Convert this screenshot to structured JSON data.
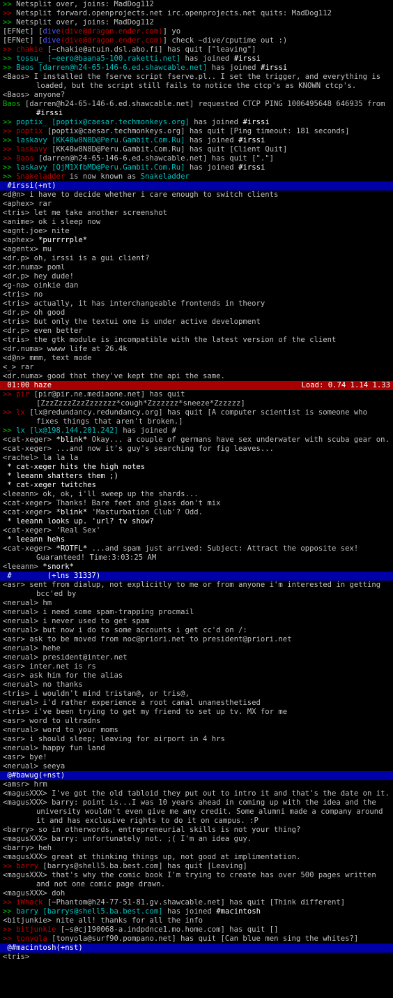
{
  "window": {
    "title": "irssi"
  },
  "lines": [
    {
      "kind": "line",
      "segs": [
        [
          ">> ",
          "g"
        ],
        [
          "Netsplit over, joins: MadDog112",
          ""
        ]
      ]
    },
    {
      "kind": "line",
      "segs": [
        [
          ">> ",
          "r"
        ],
        [
          "Netsplit forward.openprojects.net irc.openprojects.net quits: MadDog112",
          ""
        ]
      ]
    },
    {
      "kind": "line",
      "segs": [
        [
          ">> ",
          "g"
        ],
        [
          "Netsplit over, joins: MadDog112",
          ""
        ]
      ]
    },
    {
      "kind": "line",
      "segs": [
        [
          "[EFNet] [",
          ""
        ],
        [
          "dive",
          "b"
        ],
        [
          "(dive@dragon.ender.com)",
          "r"
        ],
        [
          "] yo",
          ""
        ]
      ]
    },
    {
      "kind": "line",
      "segs": [
        [
          "[EFNet] [",
          ""
        ],
        [
          "dive",
          "b"
        ],
        [
          "(dive@dragon.ender.com)",
          "r"
        ],
        [
          "] check ~dive/cputime out :)",
          ""
        ]
      ]
    },
    {
      "kind": "line",
      "segs": [
        [
          ">> ",
          "r"
        ],
        [
          "chakie ",
          "r"
        ],
        [
          "[~chakie@atuin.dsl.abo.fi] has quit [\"leaving\"]",
          ""
        ]
      ]
    },
    {
      "kind": "line",
      "segs": [
        [
          ">> ",
          "g"
        ],
        [
          "tossu_ ",
          "c"
        ],
        [
          "[~eero@baana5-100.raketti.net] ",
          "c"
        ],
        [
          "has joined ",
          ""
        ],
        [
          "#irssi",
          "w"
        ]
      ]
    },
    {
      "kind": "line",
      "segs": [
        [
          ">> ",
          "g"
        ],
        [
          "Baos ",
          "c"
        ],
        [
          "[darren@h24-65-146-6.ed.shawcable.net] ",
          "c"
        ],
        [
          "has joined ",
          ""
        ],
        [
          "#irssi",
          "w"
        ]
      ]
    },
    {
      "kind": "wrap",
      "segs": [
        [
          "<Baos> I installed the fserve script fserve.pl.. I set the trigger, and everything is loaded, but the script still fails to notice the ctcp's as KNOWN ctcp's.",
          ""
        ]
      ]
    },
    {
      "kind": "line",
      "segs": [
        [
          "<Baos> anyone?",
          ""
        ]
      ]
    },
    {
      "kind": "wrap",
      "segs": [
        [
          "Baos ",
          "g"
        ],
        [
          "[darren@h24-65-146-6.ed.shawcable.net] requested CTCP PING 1006495648 646935 from ",
          ""
        ],
        [
          "#irssi",
          "w"
        ]
      ]
    },
    {
      "kind": "line",
      "segs": [
        [
          ">> ",
          "g"
        ],
        [
          "poptix_ ",
          "c"
        ],
        [
          "[poptix@caesar.techmonkeys.org] ",
          "c"
        ],
        [
          "has joined ",
          ""
        ],
        [
          "#irssi",
          "w"
        ]
      ]
    },
    {
      "kind": "line",
      "segs": [
        [
          ">> ",
          "r"
        ],
        [
          "poptix ",
          "r"
        ],
        [
          "[poptix@caesar.techmonkeys.org] has quit [Ping timeout: 181 seconds]",
          ""
        ]
      ]
    },
    {
      "kind": "line",
      "segs": [
        [
          ">> ",
          "g"
        ],
        [
          "laskavy ",
          "c"
        ],
        [
          "[KK48w8N8D@Peru.Gambit.Com.Ru] ",
          "c"
        ],
        [
          "has joined ",
          ""
        ],
        [
          "#irssi",
          "w"
        ]
      ]
    },
    {
      "kind": "line",
      "segs": [
        [
          ">> ",
          "r"
        ],
        [
          "laskavy ",
          "r"
        ],
        [
          "[KK48w8N8D@Peru.Gambit.Com.Ru] has quit [Client Quit]",
          ""
        ]
      ]
    },
    {
      "kind": "line",
      "segs": [
        [
          ">> ",
          "r"
        ],
        [
          "Baos ",
          "r"
        ],
        [
          "[darren@h24-65-146-6.ed.shawcable.net] has quit [\".\"]",
          ""
        ]
      ]
    },
    {
      "kind": "line",
      "segs": [
        [
          ">> ",
          "g"
        ],
        [
          "laskavy ",
          "c"
        ],
        [
          "[QjM1XfbMD@Peru.Gambit.Com.Ru] ",
          "c"
        ],
        [
          "has joined ",
          ""
        ],
        [
          "#irssi",
          "w"
        ]
      ]
    },
    {
      "kind": "line",
      "segs": [
        [
          ">> ",
          "g"
        ],
        [
          "Snakeladder ",
          "r"
        ],
        [
          "is now known as ",
          ""
        ],
        [
          "Snakeladder",
          "c"
        ]
      ]
    },
    {
      "kind": "status",
      "left": " #irssi(+nt)",
      "right": ""
    },
    {
      "kind": "line",
      "segs": [
        [
          "<d@n> i have to decide whether i care enough to switch clients",
          ""
        ]
      ]
    },
    {
      "kind": "line",
      "segs": [
        [
          "<aphex> rar",
          ""
        ]
      ]
    },
    {
      "kind": "line",
      "segs": [
        [
          "<tris> let me take another screenshot",
          ""
        ]
      ]
    },
    {
      "kind": "line",
      "segs": [
        [
          "<anime> ok i sleep now",
          ""
        ]
      ]
    },
    {
      "kind": "line",
      "segs": [
        [
          "<agnt.joe> nite",
          ""
        ]
      ]
    },
    {
      "kind": "line",
      "segs": [
        [
          "<aphex> ",
          ""
        ],
        [
          "*purrrrple*",
          "w"
        ]
      ]
    },
    {
      "kind": "line",
      "segs": [
        [
          "<agentx> mu",
          ""
        ]
      ]
    },
    {
      "kind": "line",
      "segs": [
        [
          "<dr.p> oh, irssi is a gui client?",
          ""
        ]
      ]
    },
    {
      "kind": "line",
      "segs": [
        [
          "<dr.numa> poml",
          ""
        ]
      ]
    },
    {
      "kind": "line",
      "segs": [
        [
          "<dr.p> hey dude!",
          ""
        ]
      ]
    },
    {
      "kind": "line",
      "segs": [
        [
          "<g-na> oinkie dan",
          ""
        ]
      ]
    },
    {
      "kind": "line",
      "segs": [
        [
          "<tris> no",
          ""
        ]
      ]
    },
    {
      "kind": "line",
      "segs": [
        [
          "<tris> actually, it has interchangeable frontends in theory",
          ""
        ]
      ]
    },
    {
      "kind": "line",
      "segs": [
        [
          "<dr.p> oh good",
          ""
        ]
      ]
    },
    {
      "kind": "line",
      "segs": [
        [
          "<tris> but only the textui one is under active development",
          ""
        ]
      ]
    },
    {
      "kind": "line",
      "segs": [
        [
          "<dr.p> even better",
          ""
        ]
      ]
    },
    {
      "kind": "line",
      "segs": [
        [
          "<tris> the gtk module is incompatible with the latest version of the client",
          ""
        ]
      ]
    },
    {
      "kind": "line",
      "segs": [
        [
          "<dr.numa> wwww life at 26.4k",
          ""
        ]
      ]
    },
    {
      "kind": "line",
      "segs": [
        [
          "<d@n> mmm, text mode",
          ""
        ]
      ]
    },
    {
      "kind": "line",
      "segs": [
        [
          "<_> rar",
          ""
        ]
      ]
    },
    {
      "kind": "line",
      "segs": [
        [
          "<dr.numa> good that they've kept the api the same.",
          ""
        ]
      ]
    },
    {
      "kind": "status-red",
      "left": " 01:00 haze",
      "right": "Load: 0.74 1.14 1.33"
    },
    {
      "kind": "wrap",
      "segs": [
        [
          ">> ",
          "r"
        ],
        [
          "pir ",
          "r"
        ],
        [
          "[pir@pir.ne.mediaone.net] has quit [ZzzZzzzZzzZzzzzzz*cough*Zzzzzzz*sneeze*Zzzzzz]",
          ""
        ]
      ]
    },
    {
      "kind": "wrap",
      "segs": [
        [
          ">> ",
          "r"
        ],
        [
          "lx ",
          "r"
        ],
        [
          "[lx@redundancy.redundancy.org] has quit [A computer scientist is someone who fixes things that aren't broken.]",
          ""
        ]
      ]
    },
    {
      "kind": "line",
      "segs": [
        [
          ">> ",
          "g"
        ],
        [
          "lx ",
          "c"
        ],
        [
          "[lx@198.144.201.242] ",
          "c"
        ],
        [
          "has joined #",
          ""
        ]
      ]
    },
    {
      "kind": "wrap",
      "segs": [
        [
          "<cat-xeger> ",
          ""
        ],
        [
          "*blink*",
          "w"
        ],
        [
          " Okay... a couple of germans have sex underwater with scuba gear on.",
          ""
        ]
      ]
    },
    {
      "kind": "line",
      "segs": [
        [
          "<cat-xeger> ...and now it's guy's searching for fig leaves...",
          ""
        ]
      ]
    },
    {
      "kind": "line",
      "segs": [
        [
          "<rachel> la la la",
          ""
        ]
      ]
    },
    {
      "kind": "line",
      "segs": [
        [
          " * cat-xeger hits the high notes",
          "w"
        ]
      ]
    },
    {
      "kind": "line",
      "segs": [
        [
          " * leeann shatters them ;)",
          "w"
        ]
      ]
    },
    {
      "kind": "line",
      "segs": [
        [
          " * cat-xeger twitches",
          "w"
        ]
      ]
    },
    {
      "kind": "line",
      "segs": [
        [
          "<leeann> ok, ok, i'll sweep up the shards...",
          ""
        ]
      ]
    },
    {
      "kind": "line",
      "segs": [
        [
          "<cat-xeger> Thanks! Bare feet and glass don't mix",
          ""
        ]
      ]
    },
    {
      "kind": "line",
      "segs": [
        [
          "<cat-xeger> ",
          ""
        ],
        [
          "*blink*",
          "w"
        ],
        [
          " 'Masturbation Club'? Odd.",
          ""
        ]
      ]
    },
    {
      "kind": "line",
      "segs": [
        [
          " * leeann looks up. 'url? tv show?",
          "w"
        ]
      ]
    },
    {
      "kind": "line",
      "segs": [
        [
          "<cat-xeger> 'Real Sex'",
          ""
        ]
      ]
    },
    {
      "kind": "line",
      "segs": [
        [
          " * leeann hehs",
          "w"
        ]
      ]
    },
    {
      "kind": "wrap",
      "segs": [
        [
          "<cat-xeger> ",
          ""
        ],
        [
          "*ROTFL*",
          "w"
        ],
        [
          " ...and spam just arrived: Subject: Attract the opposite sex! Guaranteed! Time:3:03:25 AM",
          ""
        ]
      ]
    },
    {
      "kind": "line",
      "segs": [
        [
          "<leeann> ",
          ""
        ],
        [
          "*snork*",
          "w"
        ]
      ]
    },
    {
      "kind": "status",
      "left": " #        (+lns 31337)",
      "right": ""
    },
    {
      "kind": "wrap",
      "segs": [
        [
          "<asr> sent from dialup, not explicitly to me or from anyone i'm interested in getting bcc'ed by",
          ""
        ]
      ]
    },
    {
      "kind": "line",
      "segs": [
        [
          "<nerual> hm",
          ""
        ]
      ]
    },
    {
      "kind": "line",
      "segs": [
        [
          "<nerual> i need some spam-trapping procmail",
          ""
        ]
      ]
    },
    {
      "kind": "line",
      "segs": [
        [
          "<nerual> i never used to get spam",
          ""
        ]
      ]
    },
    {
      "kind": "line",
      "segs": [
        [
          "<nerual> but now i do to some accounts i get cc'd on /:",
          ""
        ]
      ]
    },
    {
      "kind": "line",
      "segs": [
        [
          "<asr> ask to be moved from noc@priori.net to president@priori.net",
          ""
        ]
      ]
    },
    {
      "kind": "line",
      "segs": [
        [
          "<nerual> hehe",
          ""
        ]
      ]
    },
    {
      "kind": "line",
      "segs": [
        [
          "<nerual> president@inter.net",
          ""
        ]
      ]
    },
    {
      "kind": "line",
      "segs": [
        [
          "<asr> inter.net is rs",
          ""
        ]
      ]
    },
    {
      "kind": "line",
      "segs": [
        [
          "<asr> ask him for the alias",
          ""
        ]
      ]
    },
    {
      "kind": "line",
      "segs": [
        [
          "<nerual> no thanks",
          ""
        ]
      ]
    },
    {
      "kind": "line",
      "segs": [
        [
          "<tris> i wouldn't mind tristan@, or tris@,",
          ""
        ]
      ]
    },
    {
      "kind": "line",
      "segs": [
        [
          "<nerual> i'd rather experience a root canal unanesthetised",
          ""
        ]
      ]
    },
    {
      "kind": "line",
      "segs": [
        [
          "<tris> i've been trying to get my friend to set up tv. MX for me",
          ""
        ]
      ]
    },
    {
      "kind": "line",
      "segs": [
        [
          "<asr> word to ultradns",
          ""
        ]
      ]
    },
    {
      "kind": "line",
      "segs": [
        [
          "<nerual> word to your moms",
          ""
        ]
      ]
    },
    {
      "kind": "line",
      "segs": [
        [
          "<asr> i should sleep; leaving for airport in 4 hrs",
          ""
        ]
      ]
    },
    {
      "kind": "line",
      "segs": [
        [
          "<nerual> happy fun land",
          ""
        ]
      ]
    },
    {
      "kind": "line",
      "segs": [
        [
          "<asr> bye!",
          ""
        ]
      ]
    },
    {
      "kind": "line",
      "segs": [
        [
          "<nerual> seeya",
          ""
        ]
      ]
    },
    {
      "kind": "status",
      "left": " @#bawug(+nst)",
      "right": ""
    },
    {
      "kind": "line",
      "segs": [
        [
          "<amsr> hrm",
          ""
        ]
      ]
    },
    {
      "kind": "wrap",
      "segs": [
        [
          "<magusXXX> I've got the old tabloid they put out to intro it and that's the date on it.",
          ""
        ]
      ]
    },
    {
      "kind": "wrap",
      "segs": [
        [
          "<magusXXX> barry: point is...I was 10 years ahead in coming up with the idea and the university wouldn't even give me any credit. Some alumni made a company around it and has exclusive rights to do it on campus. :P",
          ""
        ]
      ]
    },
    {
      "kind": "line",
      "segs": [
        [
          "<barry> so in otherwords, entrepreneurial skills is not your thing?",
          ""
        ]
      ]
    },
    {
      "kind": "line",
      "segs": [
        [
          "<magusXXX> barry: unfortunately not. ;( I'm an idea guy.",
          ""
        ]
      ]
    },
    {
      "kind": "line",
      "segs": [
        [
          "<barry> heh",
          ""
        ]
      ]
    },
    {
      "kind": "line",
      "segs": [
        [
          "<magusXXX> great at thinking things up, not good at implimentation.",
          ""
        ]
      ]
    },
    {
      "kind": "line",
      "segs": [
        [
          ">> ",
          "r"
        ],
        [
          "barry ",
          "r"
        ],
        [
          "[barrys@shell5.ba.best.com] has quit [Leaving]",
          ""
        ]
      ]
    },
    {
      "kind": "wrap",
      "segs": [
        [
          "<magusXXX> that's why the comic book I'm trying to create has over 500 pages written and not one comic page drawn.",
          ""
        ]
      ]
    },
    {
      "kind": "line",
      "segs": [
        [
          "<magusXXX> doh",
          ""
        ]
      ]
    },
    {
      "kind": "line",
      "segs": [
        [
          ">> ",
          "r"
        ],
        [
          "iWhack ",
          "r"
        ],
        [
          "[~Phantom@h24-77-51-81.gv.shawcable.net] has quit [Think different]",
          ""
        ]
      ]
    },
    {
      "kind": "line",
      "segs": [
        [
          ">> ",
          "g"
        ],
        [
          "barry ",
          "c"
        ],
        [
          "[barrys@shell5.ba.best.com] ",
          "c"
        ],
        [
          "has joined ",
          ""
        ],
        [
          "#macintosh",
          "w"
        ]
      ]
    },
    {
      "kind": "line",
      "segs": [
        [
          "<bitjunkie> nite all! thanks for all the info",
          ""
        ]
      ]
    },
    {
      "kind": "line",
      "segs": [
        [
          ">> ",
          "r"
        ],
        [
          "bitjunkie ",
          "r"
        ],
        [
          "[~s@cj190068-a.indpdnce1.mo.home.com] has quit []",
          ""
        ]
      ]
    },
    {
      "kind": "line",
      "segs": [
        [
          ">> ",
          "r"
        ],
        [
          "tonyola ",
          "r"
        ],
        [
          "[tonyola@surf90.pompano.net] has quit [Can blue men sing the whites?]",
          ""
        ]
      ]
    },
    {
      "kind": "status",
      "left": " @#macintosh(+nst)",
      "right": ""
    },
    {
      "kind": "line",
      "segs": [
        [
          "<tris> ",
          ""
        ]
      ]
    }
  ]
}
